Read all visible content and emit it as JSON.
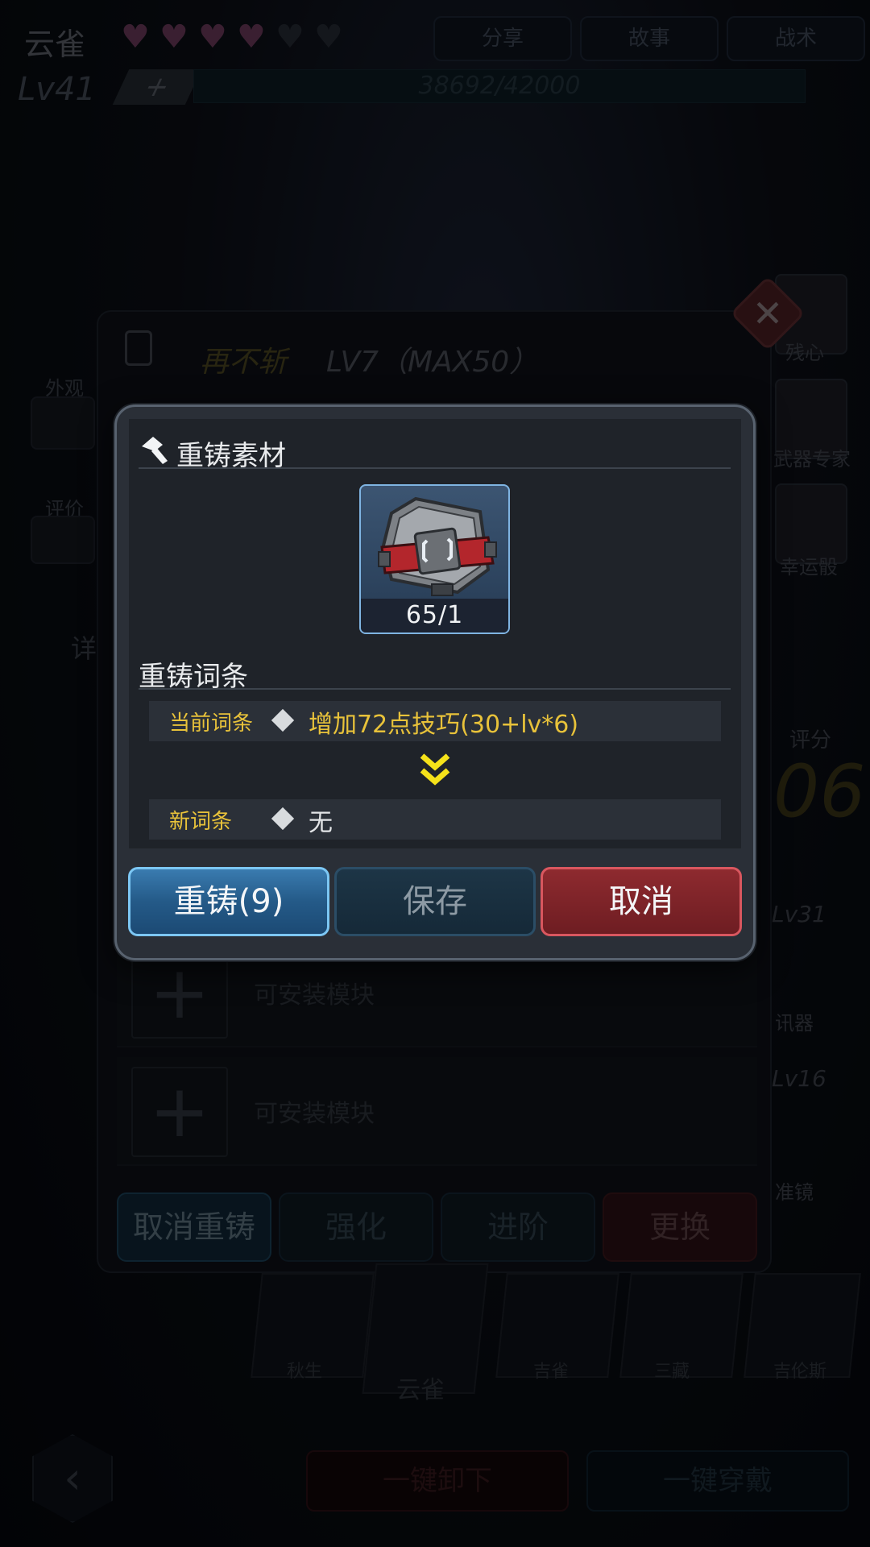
{
  "background": {
    "character_name": "云雀",
    "top_buttons": [
      "分享",
      "故事",
      "战术"
    ],
    "level": "Lv41",
    "exp": "38692/42000",
    "left_side": [
      "外观",
      "评价",
      "详"
    ],
    "right_side": [
      "残心",
      "武器专家",
      "幸运骰"
    ],
    "score_label": "评分",
    "score_value": "06",
    "equipment": {
      "name": "再不斩",
      "level": "LV7（MAX50）"
    },
    "module_slots": [
      "可安装模块",
      "可安装模块"
    ],
    "equipment_buttons": [
      "取消重铸",
      "强化",
      "进阶",
      "更换"
    ],
    "right_levels": [
      "Lv31",
      "Lv16"
    ],
    "right_level_labels": [
      "讯器",
      "准镜"
    ],
    "characters": [
      "秋生",
      "云雀",
      "吉雀",
      "三藏",
      "吉伦斯"
    ],
    "bottom_buttons": [
      "一键卸下",
      "一键穿戴"
    ]
  },
  "dialog": {
    "material_section_title": "重铸素材",
    "material_count": "65/1",
    "affix_section_title": "重铸词条",
    "current_affix_label": "当前词条",
    "current_affix_value": "增加72点技巧(30+lv*6)",
    "new_affix_label": "新词条",
    "new_affix_value": "无",
    "buttons": {
      "reforge": "重铸(9)",
      "save": "保存",
      "cancel": "取消"
    }
  },
  "colors": {
    "gold_text": "#e8c23a",
    "reforge_blue": "#2b6598",
    "cancel_red": "#7d2328",
    "dialog_bg": "#2a2f37"
  }
}
